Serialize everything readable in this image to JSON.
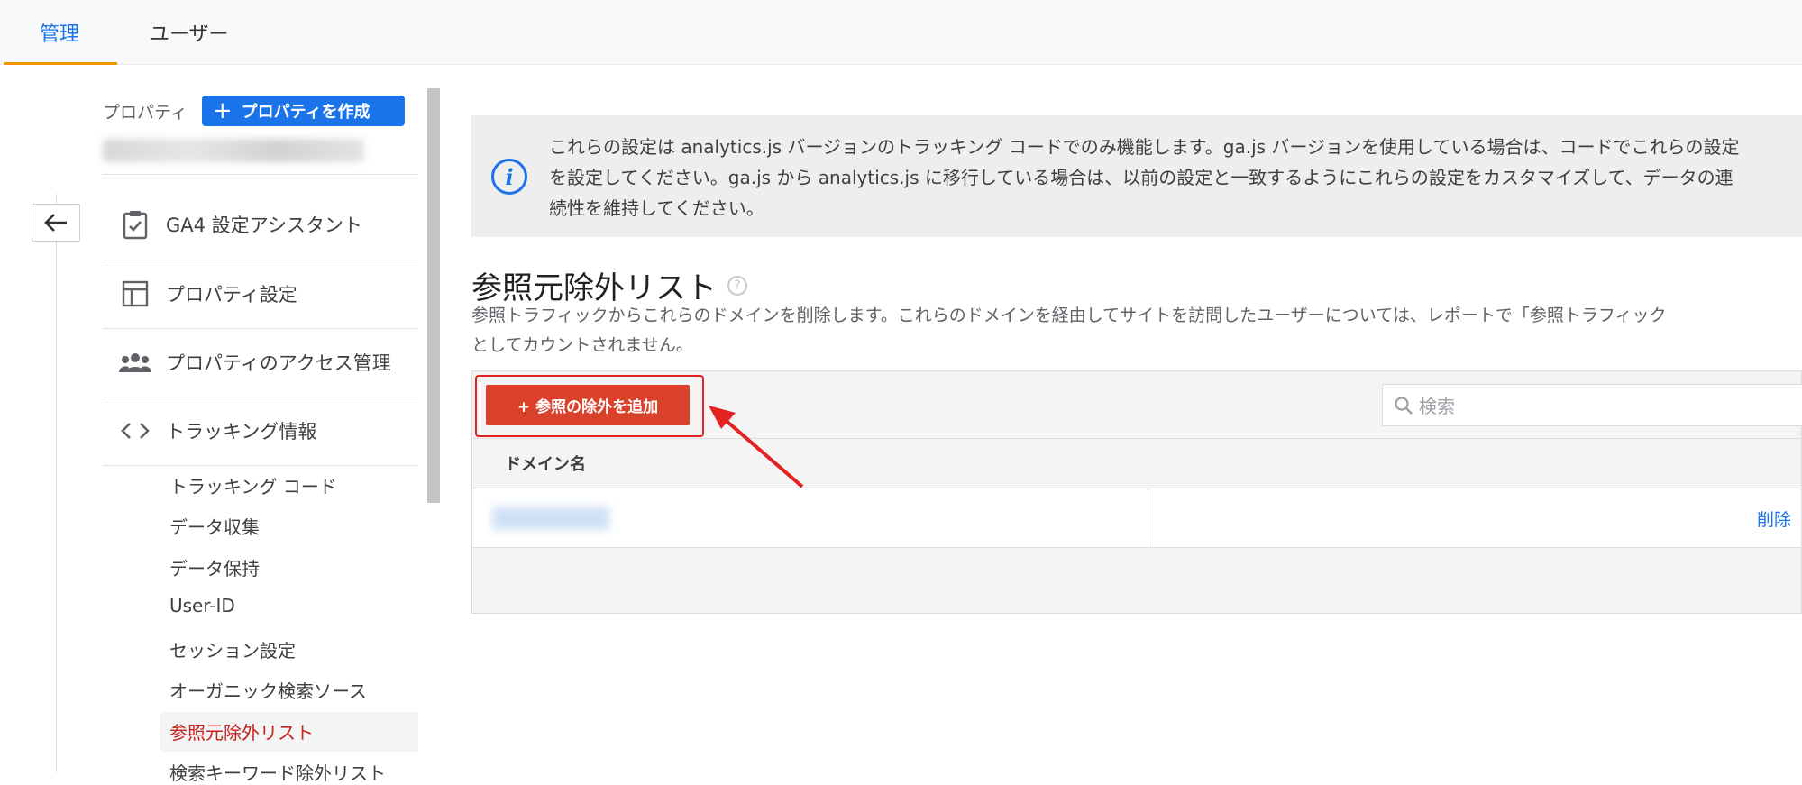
{
  "tabs": {
    "admin": "管理",
    "user": "ユーザー"
  },
  "sidebar": {
    "property_label": "プロパティ",
    "create_button": "プロパティを作成",
    "create_plus": "+",
    "items": [
      {
        "label": "GA4 設定アシスタント",
        "icon": "clipboard-check-icon"
      },
      {
        "label": "プロパティ設定",
        "icon": "layout-icon"
      },
      {
        "label": "プロパティのアクセス管理",
        "icon": "people-icon"
      },
      {
        "label": "トラッキング情報",
        "icon": "code-icon"
      }
    ],
    "subitems": [
      "トラッキング コード",
      "データ収集",
      "データ保持",
      "User-ID",
      "セッション設定",
      "オーガニック検索ソース",
      "参照元除外リスト",
      "検索キーワード除外リスト"
    ]
  },
  "info": {
    "icon": "i",
    "line1": "これらの設定は analytics.js バージョンのトラッキング コードでのみ機能します。ga.js バージョンを使用している場合は、コードでこれらの設定",
    "line2": "を設定してください。ga.js から analytics.js に移行している場合は、以前の設定と一致するようにこれらの設定をカスタマイズして、データの連",
    "line3": "続性を維持してください。"
  },
  "page": {
    "title": "参照元除外リスト",
    "help": "?",
    "desc1": "参照トラフィックからこれらのドメインを削除します。これらのドメインを経由してサイトを訪問したユーザーについては、レポートで「参照トラフィック",
    "desc2": "としてカウントされません。"
  },
  "table": {
    "add_button": "+ 参照の除外を追加",
    "search_placeholder": "検索",
    "column_domain": "ドメイン名",
    "row_delete": "削除"
  },
  "colors": {
    "accent": "#1a73e8",
    "add_button": "#d9412a",
    "highlight": "#e52222",
    "active_tab_underline": "#f29400"
  }
}
